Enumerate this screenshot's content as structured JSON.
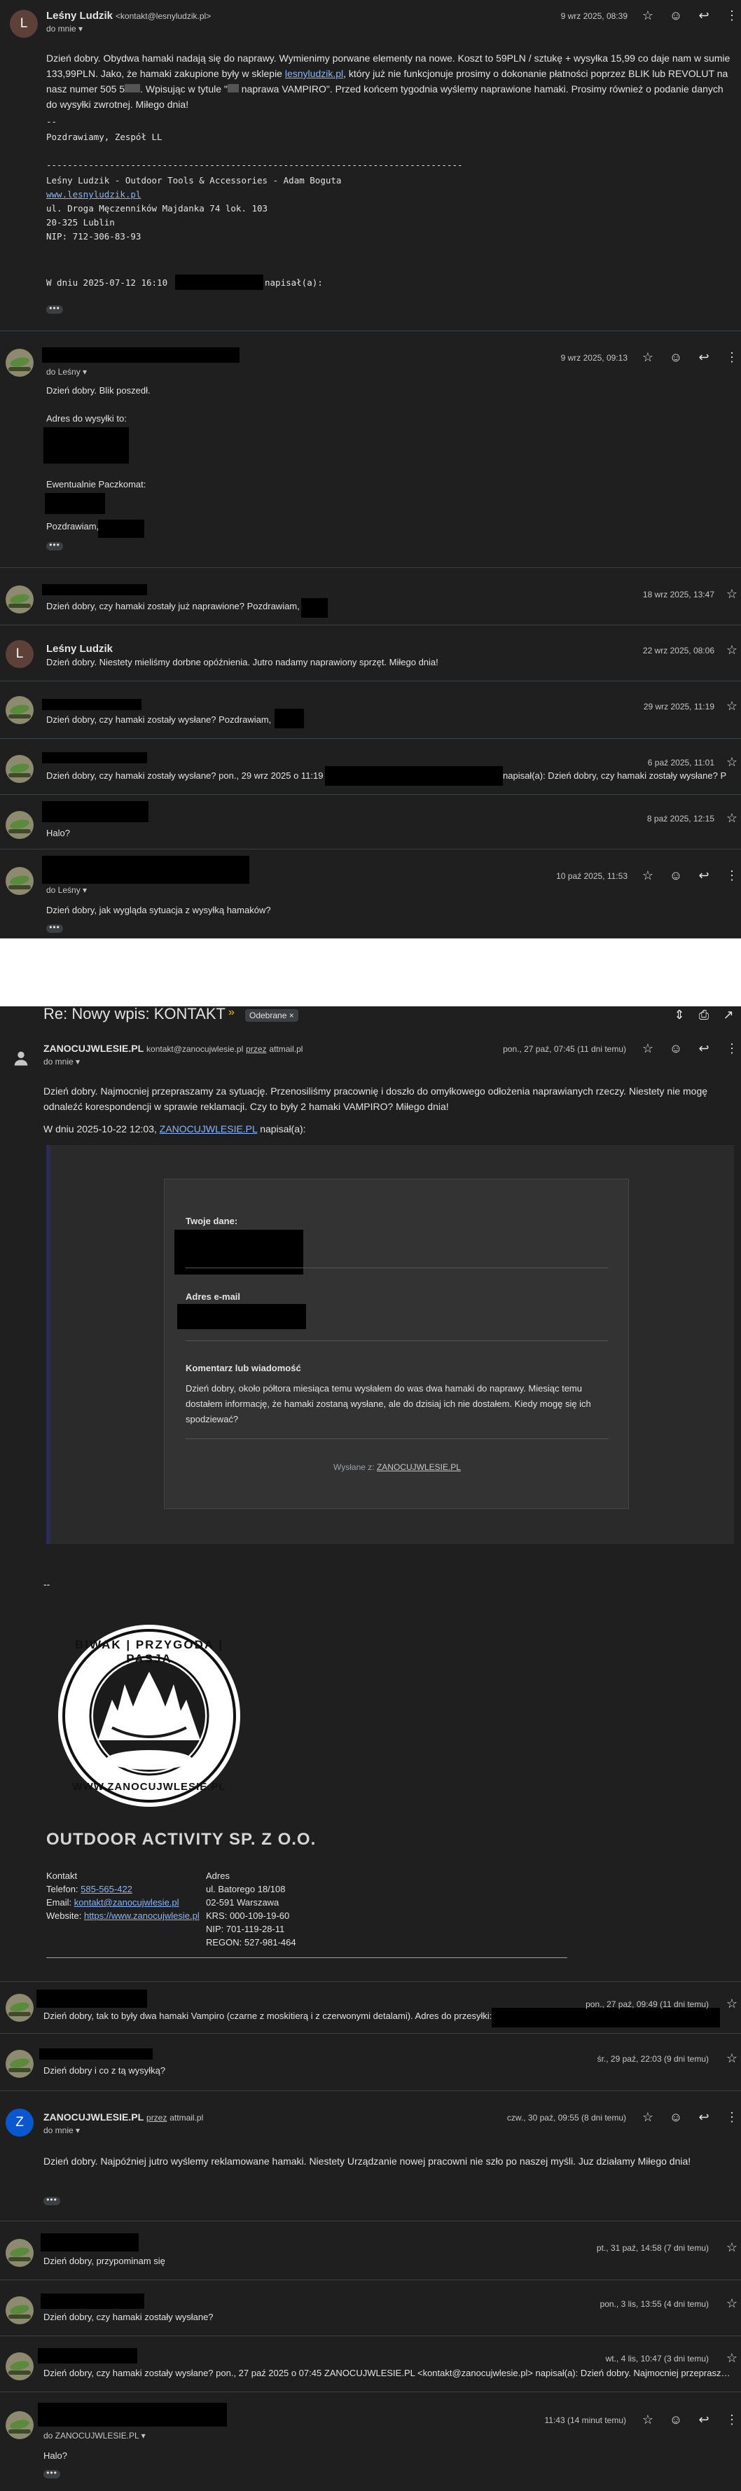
{
  "m1": {
    "avatar": "L",
    "sender": "Leśny Ludzik",
    "email": "<kontakt@lesnyludzik.pl>",
    "to": "do mnie",
    "date": "9 wrz 2025, 08:39",
    "body_a": "Dzień dobry. Obydwa hamaki nadają się do naprawy. Wymienimy porwane elementy na nowe. Koszt to 59PLN / sztukę + wysyłka 15,99 co daje nam w sumie 133,99PLN. Jako, że hamaki zakupione były w sklepie",
    "body_link": "lesnyludzik.pl",
    "body_b": ", który już nie funkcjonuje prosimy o dokonanie płatności poprzez BLIK lub REVOLUT na nasz numer 505 5",
    "body_c": ". Wpisując w tytule \"",
    "body_d": "naprawa VAMPIRO\". Przed końcem tygodnia wyślemy naprawione hamaki. Prosimy również o podanie danych do wysyłki zwrotnej. Miłego dnia!",
    "sig_dash": "--",
    "sig_greet": "Pozdrawiamy, Zespół LL",
    "sig_rule": "-------------------------------------------------------------------------------",
    "sig_company": "Leśny Ludzik - Outdoor Tools & Accessories - Adam Boguta",
    "sig_www": "www.lesnyludzik.pl",
    "sig_street": "ul. Droga Męczenników Majdanka 74 lok. 103",
    "sig_city": "20-325 Lublin",
    "sig_nip": "NIP: 712-306-83-93",
    "quote_a": "W dniu 2025-07-12 16:10",
    "quote_b": "napisał(a):"
  },
  "m2": {
    "to": "do Leśny",
    "date": "9 wrz 2025, 09:13",
    "l1": "Dzień dobry. Blik poszedł.",
    "l2": "Adres do wysyłki to:",
    "l3": "Ewentualnie Paczkomat:",
    "l4": "Pozdrawiam,"
  },
  "m3": {
    "date": "18 wrz 2025, 13:47",
    "snippet": "Dzień dobry, czy hamaki zostały już naprawione? Pozdrawiam,"
  },
  "m4": {
    "avatar": "L",
    "sender": "Leśny Ludzik",
    "date": "22 wrz 2025, 08:06",
    "snippet": "Dzień dobry. Niestety mieliśmy dorbne opóźnienia. Jutro nadamy naprawiony sprzęt. Miłego dnia!"
  },
  "m5": {
    "date": "29 wrz 2025, 11:19",
    "snippet": "Dzień dobry, czy hamaki zostały wysłane? Pozdrawiam,"
  },
  "m6": {
    "date": "6 paź 2025, 11:01",
    "snippet_a": "Dzień dobry, czy hamaki zostały wysłane? pon., 29 wrz 2025 o 11:19",
    "snippet_b": "napisał(a): Dzień dobry, czy hamaki zostały wysłane? P"
  },
  "m7": {
    "date": "8 paź 2025, 12:15",
    "snippet": "Halo?"
  },
  "m8": {
    "to": "do Leśny",
    "date": "10 paź 2025, 11:53",
    "body": "Dzień dobry, jak wygląda sytuacja z wysyłką hamaków?"
  },
  "thread": {
    "subject": "Re: Nowy wpis: KONTAKT",
    "label": "Odebrane",
    "label_close": "×"
  },
  "n1": {
    "sender": "ZANOCUJWLESIE.PL",
    "email": "kontakt@zanocujwlesie.pl",
    "via": "przez",
    "via_domain": "attmail.pl",
    "to": "do mnie",
    "date": "pon., 27 paź, 07:45 (11 dni temu)",
    "body": "Dzień dobry. Najmocniej przepraszamy za sytuację. Przenosiliśmy pracownię i doszło do omyłkowego odłożenia naprawianych rzeczy.  Niestety nie mogę odnaleźć korespondencji w sprawie reklamacji. Czy to były 2 hamaki VAMPIRO? Miłego dnia!",
    "quote_a": "W dniu 2025-10-22 12:03,",
    "quote_link": "ZANOCUJWLESIE.PL",
    "quote_b": "napisał(a):",
    "card_l1": "Twoje dane:",
    "card_l2": "Adres e-mail",
    "card_l3": "Komentarz lub wiadomość",
    "card_msg": "Dzień dobry, około półtora miesiąca temu wysłałem do was dwa hamaki do naprawy. Miesiąc temu dostałem informację, że hamaki zostaną wysłane, ale do dzisiaj ich nie dostałem. Kiedy mogę się ich spodziewać?",
    "card_foot_a": "Wysłane z:",
    "card_foot_link": "ZANOCUJWLESIE.PL",
    "dash": "--",
    "logo_top": "BIWAK | PRZYGODA | PASJA",
    "logo_bottom": "WWW.ZANOCUJWLESIE.PL",
    "company": "OUTDOOR ACTIVITY SP. Z O.O.",
    "c1_h": "Kontakt",
    "c1_tel_l": "Telefon:",
    "c1_tel": "585-565-422",
    "c1_mail_l": "Email:",
    "c1_mail": "kontakt@zanocujwlesie.pl",
    "c1_web_l": "Website:",
    "c1_web": "https://www.zanocujwlesie.pl",
    "c2_h": "Adres",
    "c2_l1": "ul. Batorego 18/108",
    "c2_l2": "02-591 Warszawa",
    "c2_l3": "KRS: 000-109-19-60",
    "c2_l4": "NIP: 701-119-28-11",
    "c2_l5": "REGON: 527-981-464"
  },
  "n2": {
    "date": "pon., 27 paź, 09:49 (11 dni temu)",
    "snippet": "Dzień dobry, tak to były dwa hamaki Vampiro (czarne z moskitierą i z czerwonymi detalami). Adres do przesyłki:"
  },
  "n3": {
    "date": "śr., 29 paź, 22:03 (9 dni temu)",
    "snippet": "Dzień dobry i co z tą wysyłką?"
  },
  "n4": {
    "avatar": "Z",
    "sender": "ZANOCUJWLESIE.PL",
    "via": "przez",
    "via_domain": "attmail.pl",
    "to": "do mnie",
    "date": "czw., 30 paź, 09:55 (8 dni temu)",
    "body": "Dzień dobry. Najpóźniej jutro wyślemy reklamowane hamaki. Niestety Urządzanie nowej pracowni nie szło po naszej myśli. Juz działamy Miłego dnia!"
  },
  "n5": {
    "date": "pt., 31 paź, 14:58 (7 dni temu)",
    "snippet": "Dzień dobry, przypominam się"
  },
  "n6": {
    "date": "pon., 3 lis, 13:55 (4 dni temu)",
    "snippet": "Dzień dobry, czy hamaki zostały wysłane?"
  },
  "n7": {
    "date": "wt., 4 lis, 10:47 (3 dni temu)",
    "snippet": "Dzień dobry, czy hamaki zostały wysłane? pon., 27 paź 2025 o 07:45 ZANOCUJWLESIE.PL <kontakt@zanocujwlesie.pl> napisał(a): Dzień dobry. Najmocniej przeprasza..."
  },
  "n8": {
    "to": "do ZANOCUJWLESIE.PL",
    "date": "11:43 (14 minut temu)",
    "body": "Halo?"
  },
  "icons": {
    "star": "star-icon",
    "emoji": "emoji-icon",
    "reply": "reply-icon",
    "more": "more-vert-icon",
    "print": "print-icon",
    "open": "open-new-window-icon",
    "expand": "unfold-icon",
    "important": "important-marker-icon"
  },
  "colors": {
    "background": "#1f1f1f",
    "link": "#8ab4f8",
    "redaction": "#000000",
    "zavatar": "#0b57d0"
  }
}
